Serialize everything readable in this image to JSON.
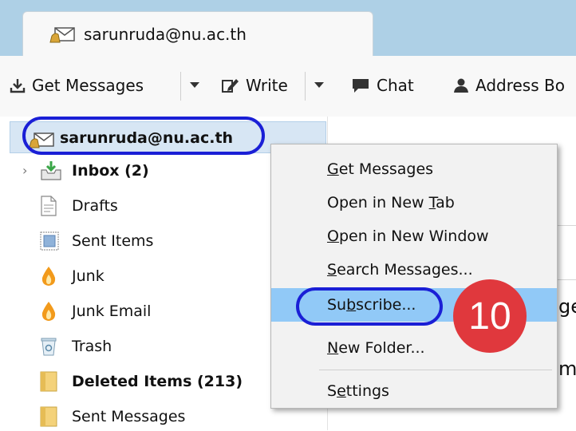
{
  "tab": {
    "title": "sarunruda@nu.ac.th"
  },
  "toolbar": {
    "get_messages": "Get Messages",
    "write": "Write",
    "chat": "Chat",
    "address_book": "Address Bo"
  },
  "account": {
    "label": "sarunruda@nu.ac.th"
  },
  "folders": [
    {
      "label": "Inbox (2)",
      "icon": "inbox-icon"
    },
    {
      "label": "Drafts",
      "icon": "drafts-icon"
    },
    {
      "label": "Sent Items",
      "icon": "sent-items-icon"
    },
    {
      "label": "Junk",
      "icon": "junk-icon"
    },
    {
      "label": "Junk Email",
      "icon": "junk-icon"
    },
    {
      "label": "Trash",
      "icon": "trash-icon"
    },
    {
      "label": "Deleted Items (213)",
      "icon": "folder-icon"
    },
    {
      "label": "Sent Messages",
      "icon": "folder-icon"
    }
  ],
  "menu": {
    "get_messages": {
      "pre": "",
      "key": "G",
      "post": "et Messages"
    },
    "open_new_tab": {
      "pre": "Open in New ",
      "key": "T",
      "post": "ab"
    },
    "open_new_window": {
      "pre": "",
      "key": "O",
      "post": "pen in New Window"
    },
    "search_messages": {
      "pre": "",
      "key": "S",
      "post": "earch Messages..."
    },
    "subscribe": {
      "pre": "Su",
      "key": "b",
      "post": "scribe..."
    },
    "new_folder": {
      "pre": "",
      "key": "N",
      "post": "ew Folder..."
    },
    "settings": {
      "pre": "S",
      "key": "e",
      "post": "ttings"
    }
  },
  "rightpane": {
    "t1": "l",
    "t2": "ge",
    "t3": "m"
  },
  "annotation": {
    "step": "10"
  },
  "colors": {
    "highlight": "#91c9f7",
    "oval": "#1a1fd6",
    "badge": "#e0383d",
    "tabbar": "#aed0e6"
  }
}
